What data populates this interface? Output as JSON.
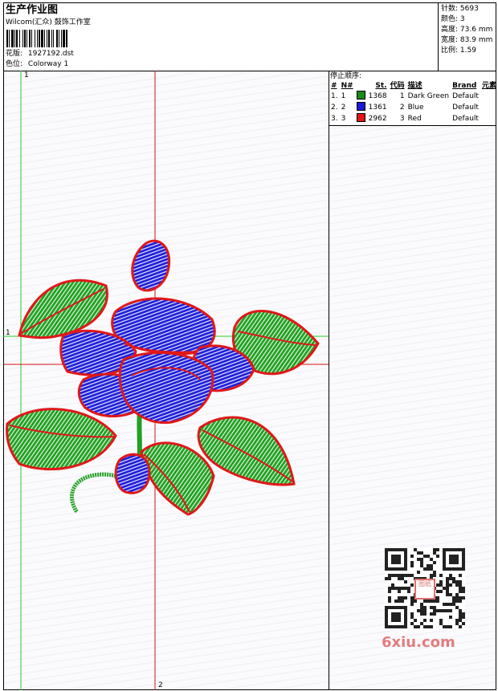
{
  "header": {
    "title": "生产作业图",
    "company": "Wilcom(汇众) 鼓饰工作室",
    "design_label": "花版:",
    "design_value": "1927192.dst",
    "colorway_label": "色位:",
    "colorway_value": "Colorway 1"
  },
  "stats": [
    {
      "label": "针数:",
      "value": "5693"
    },
    {
      "label": "颜色:",
      "value": "3"
    },
    {
      "label": "高度:",
      "value": "73.6 mm"
    },
    {
      "label": "宽度:",
      "value": "83.9 mm"
    },
    {
      "label": "比例:",
      "value": "1.59"
    }
  ],
  "sequence": {
    "title": "停止顺序:",
    "columns": [
      "#",
      "N#",
      "St.",
      "代码",
      "描述",
      "Brand",
      "元素"
    ],
    "rows": [
      {
        "num": "1.",
        "n": "1",
        "color": "#1a8a1a",
        "stitches": "1368",
        "code": "1",
        "desc": "Dark Green",
        "brand": "Default"
      },
      {
        "num": "2.",
        "n": "2",
        "color": "#1a1ad6",
        "stitches": "1361",
        "code": "2",
        "desc": "Blue",
        "brand": "Default"
      },
      {
        "num": "3.",
        "n": "3",
        "color": "#e01616",
        "stitches": "2962",
        "code": "3",
        "desc": "Red",
        "brand": "Default"
      }
    ]
  },
  "guides": {
    "v1_label": "1",
    "h1_label": "1",
    "v2_label": "2"
  },
  "watermark": {
    "site": "6xiu.com",
    "seal_text": "图纸",
    "colors": {
      "accent": "#e07070"
    }
  },
  "palette": {
    "green": "#22a022",
    "blue": "#2020d8",
    "red": "#e01818",
    "guide_green": "#22cc22",
    "guide_red": "#d01010"
  }
}
